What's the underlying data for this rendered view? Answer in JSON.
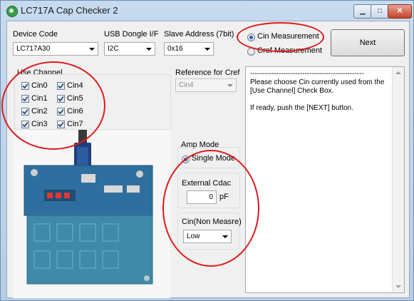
{
  "window": {
    "title": "LC717A Cap Checker 2"
  },
  "device_code": {
    "label": "Device Code",
    "value": "LC717A30"
  },
  "usb_dongle": {
    "label": "USB Dongle I/F",
    "value": "I2C"
  },
  "slave_address": {
    "label": "Slave Address (7bit)",
    "value": "0x16"
  },
  "measurement": {
    "cin_label": "Cin Measurement",
    "cref_label": "Cref Measurement",
    "selected": "cin"
  },
  "next_button": {
    "label": "Next"
  },
  "use_channel": {
    "title": "Use Channel",
    "channels": [
      "Cin0",
      "Cin1",
      "Cin2",
      "Cin3",
      "Cin4",
      "Cin5",
      "Cin6",
      "Cin7"
    ]
  },
  "reference_cref": {
    "label": "Reference for Cref",
    "value": "Cin4"
  },
  "amp_mode": {
    "label": "Amp Mode",
    "single_label": "Single Mode"
  },
  "external_cdac": {
    "label": "External Cdac",
    "value": "0",
    "unit": "pF"
  },
  "cin_non_measure": {
    "label": "Cin(Non Measre)",
    "value": "Low"
  },
  "instructions": {
    "separator": "------------------------------------------------",
    "line1": "Please choose Cin currently used from the",
    "line2": "[Use Channel] Check Box.",
    "line3": "If ready, push the [NEXT] button."
  },
  "colors": {
    "annotation_red": "#e01a1a",
    "board_blue": "#2f6f9f"
  }
}
